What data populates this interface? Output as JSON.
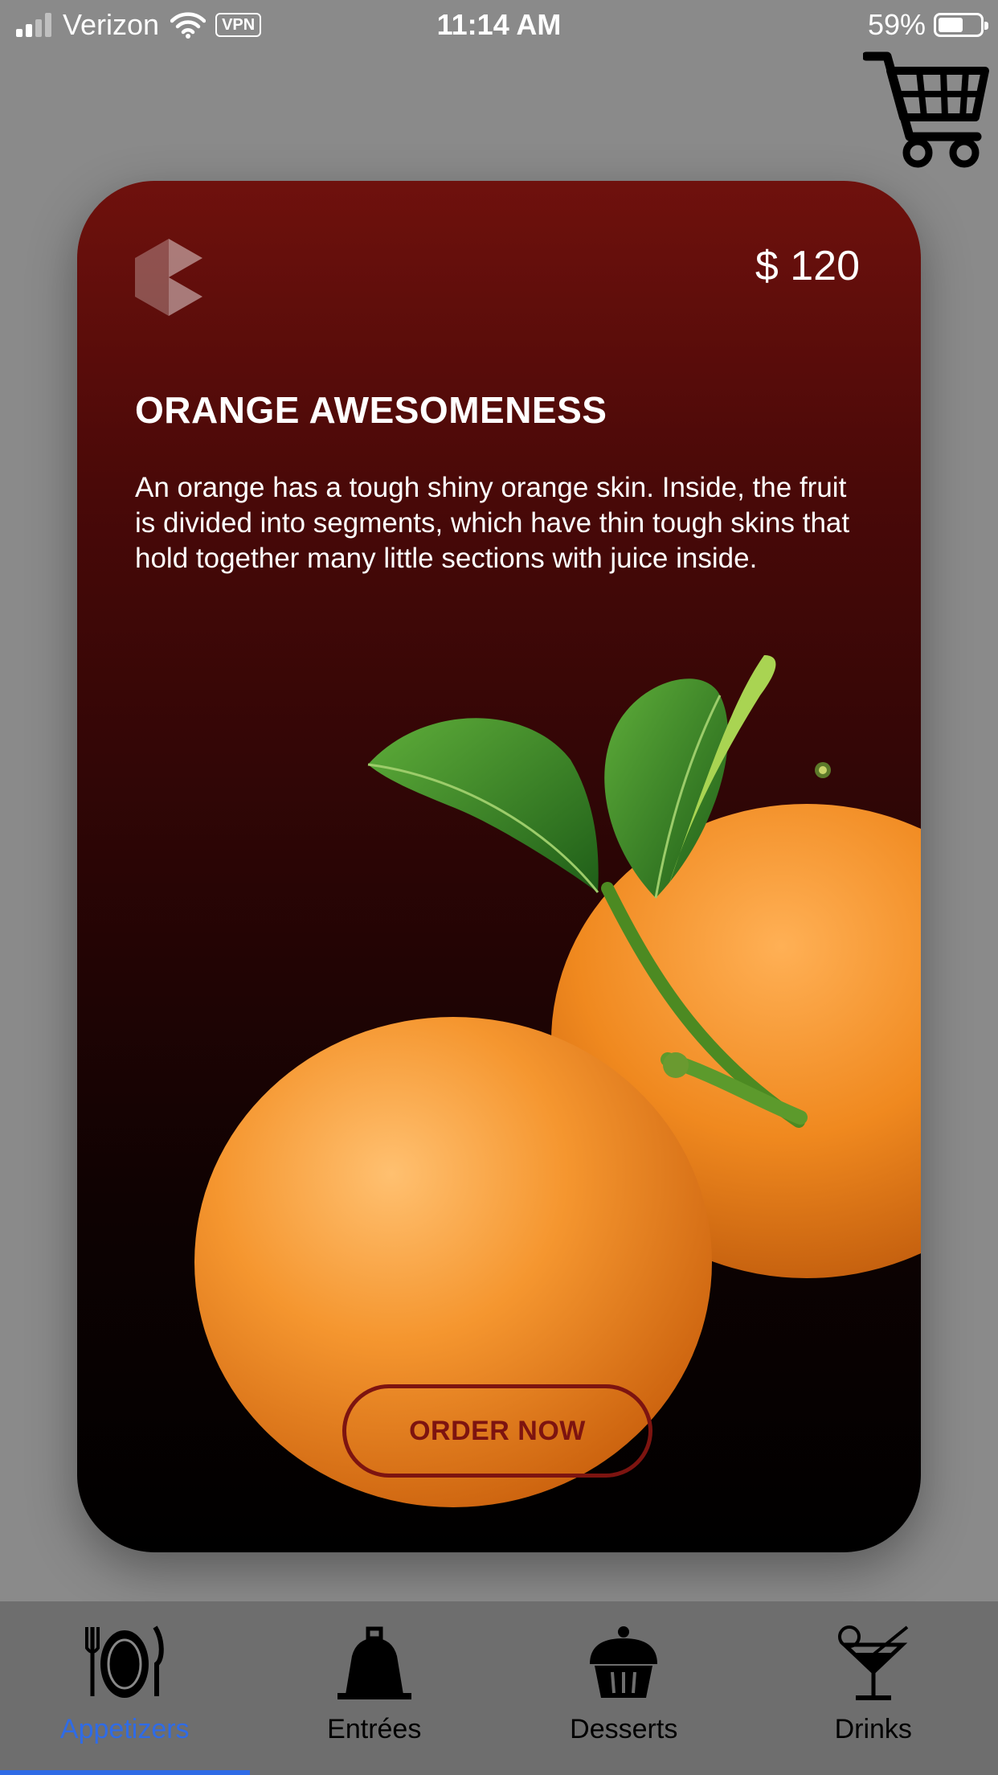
{
  "status_bar": {
    "carrier": "Verizon",
    "vpn": "VPN",
    "time": "11:14 AM",
    "battery": "59%",
    "battery_level": 0.59
  },
  "header": {
    "cart_icon": "shopping-cart-icon"
  },
  "card": {
    "price": "$ 120",
    "title": "ORANGE AWESOMENESS",
    "description": "An orange has a tough shiny orange skin. Inside, the fruit is divided into segments, which have thin tough skins that hold together many little sections with juice inside.",
    "button_label": "ORDER NOW",
    "logo_icon": "brand-logo-icon",
    "image": "oranges-illustration",
    "gradient_top": "#6f110d",
    "accent": "#7d1410"
  },
  "tab_bar": {
    "active_color": "#2f6be6",
    "items": [
      {
        "label": "Appetizers",
        "icon": "plate-utensils-icon",
        "active": true
      },
      {
        "label": "Entrées",
        "icon": "cloche-icon",
        "active": false
      },
      {
        "label": "Desserts",
        "icon": "cupcake-icon",
        "active": false
      },
      {
        "label": "Drinks",
        "icon": "cocktail-icon",
        "active": false
      }
    ]
  }
}
